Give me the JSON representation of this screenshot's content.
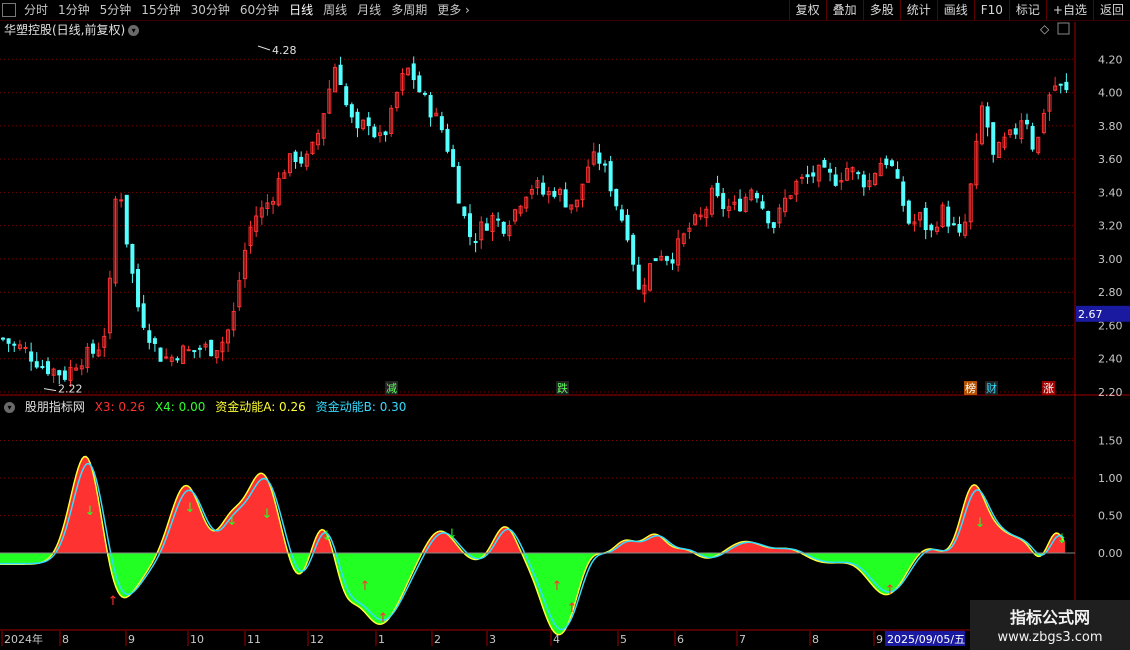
{
  "toolbar": {
    "periods": [
      "分时",
      "1分钟",
      "5分钟",
      "15分钟",
      "30分钟",
      "60分钟",
      "日线",
      "周线",
      "月线",
      "多周期",
      "更多"
    ],
    "active_period": "日线",
    "right_buttons": [
      "复权",
      "叠加",
      "多股",
      "统计",
      "画线",
      "F10",
      "标记",
      "+自选",
      "返回"
    ]
  },
  "main_chart": {
    "title": "华塑控股(日线,前复权)",
    "y_ticks": [
      "4.20",
      "4.00",
      "3.80",
      "3.60",
      "3.40",
      "3.20",
      "3.00",
      "2.80",
      "2.60",
      "2.40",
      "2.20"
    ],
    "current_price": "2.67",
    "high_label": "4.28",
    "low_label": "2.22",
    "markers": [
      "减",
      "跌",
      "榜",
      "财",
      "涨"
    ]
  },
  "indicator": {
    "name": "股朋指标网",
    "values": [
      {
        "label": "X3: 0.26",
        "color": "#ff3030"
      },
      {
        "label": "X4: 0.00",
        "color": "#30ff30"
      },
      {
        "label": "资金动能A: 0.26",
        "color": "#ffff33"
      },
      {
        "label": "资金动能B: 0.30",
        "color": "#33ddff"
      }
    ],
    "y_ticks": [
      "1.50",
      "1.00",
      "0.50",
      "0.00"
    ]
  },
  "x_axis": {
    "labels": [
      "2024年",
      "8",
      "9",
      "10",
      "11",
      "12",
      "1",
      "2",
      "3",
      "4",
      "5",
      "6",
      "7",
      "8",
      "9"
    ],
    "cursor_date": "2025/09/05/五"
  },
  "watermark": {
    "line1": "指标公式网",
    "line2": "www.zbgs3.com"
  },
  "colors": {
    "up": "#ff3232",
    "down": "#54ffff",
    "grid": "#7a0000",
    "bg": "#000000"
  },
  "chart_data": {
    "type": "candlestick",
    "symbol": "华塑控股",
    "interval": "日线",
    "y_range": [
      2.2,
      4.28
    ],
    "close_approx": [
      2.52,
      2.48,
      2.46,
      2.4,
      2.35,
      2.33,
      2.3,
      2.38,
      2.42,
      2.45,
      2.6,
      3.55,
      3.05,
      2.7,
      2.55,
      2.42,
      2.4,
      2.45,
      2.44,
      2.47,
      2.46,
      2.5,
      2.62,
      3.0,
      3.25,
      3.3,
      3.4,
      3.55,
      3.62,
      3.58,
      3.7,
      3.95,
      4.2,
      3.9,
      3.75,
      3.85,
      3.7,
      3.8,
      4.05,
      4.15,
      4.0,
      3.9,
      3.8,
      3.6,
      3.3,
      3.1,
      3.2,
      3.25,
      3.2,
      3.28,
      3.4,
      3.45,
      3.38,
      3.42,
      3.35,
      3.32,
      3.55,
      3.62,
      3.5,
      3.3,
      3.15,
      2.8,
      2.95,
      3.05,
      3.0,
      3.1,
      3.2,
      3.25,
      3.38,
      3.32,
      3.3,
      3.35,
      3.45,
      3.3,
      3.2,
      3.35,
      3.45,
      3.48,
      3.52,
      3.5,
      3.48,
      3.55,
      3.5,
      3.45,
      3.58,
      3.6,
      3.4,
      3.2,
      3.25,
      3.15,
      3.3,
      3.2,
      3.1,
      3.5,
      3.95,
      3.6,
      3.7,
      3.75,
      3.9,
      3.62,
      3.95,
      4.05,
      4.0
    ]
  }
}
